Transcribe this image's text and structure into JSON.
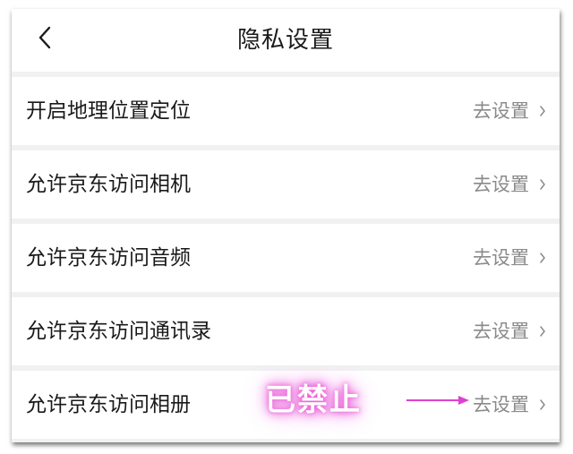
{
  "header": {
    "title": "隐私设置",
    "back_icon": "chevron-left-icon"
  },
  "settings": [
    {
      "label": "开启地理位置定位",
      "action": "去设置"
    },
    {
      "label": "允许京东访问相机",
      "action": "去设置"
    },
    {
      "label": "允许京东访问音频",
      "action": "去设置"
    },
    {
      "label": "允许京东访问通讯录",
      "action": "去设置"
    },
    {
      "label": "允许京东访问相册",
      "action": "去设置"
    }
  ],
  "annotation": {
    "text": "已禁止",
    "color": "#e040d0"
  },
  "colors": {
    "separator": "#f1f1f1",
    "label": "#1a1a1a",
    "action": "#8a8a8a"
  }
}
